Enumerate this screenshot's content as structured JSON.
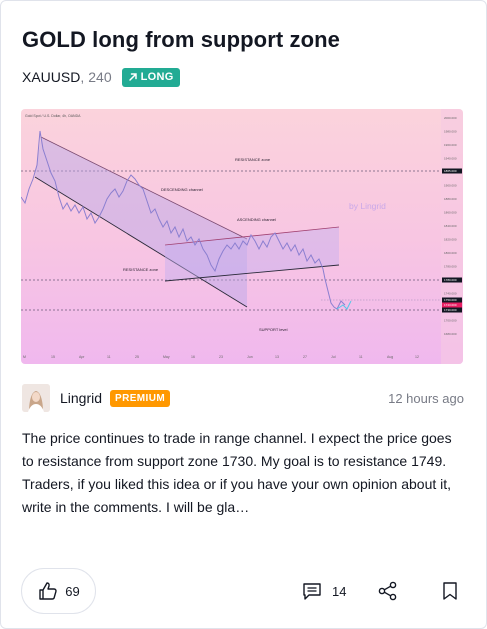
{
  "idea": {
    "title": "GOLD long from support zone",
    "symbol": "XAUUSD",
    "interval": "240",
    "direction": "LONG",
    "direction_color": "#22ab94"
  },
  "chart": {
    "header_text": "Gold Spot / U.S. Dollar, 4h, OANDA",
    "labels": {
      "resistance_top": "RESISTANCE zone",
      "descending": "DESCENDING channel",
      "ascending": "ASCENDING channel",
      "resistance_mid": "RESISTANCE zone",
      "support": "SUPPORT level",
      "watermark": "by Lingrid"
    },
    "x_ticks": [
      "M",
      "15",
      "Apr",
      "11",
      "25",
      "May",
      "16",
      "23",
      "Jun",
      "13",
      "27",
      "Jul",
      "11",
      "Aug",
      "12"
    ],
    "y_ticks": [
      "2000.000",
      "1980.000",
      "1960.000",
      "1940.000",
      "1920.000",
      "1900.000",
      "1880.000",
      "1860.000",
      "1840.000",
      "1820.000",
      "1800.000",
      "1780.000",
      "1760.000",
      "1740.000",
      "1720.000",
      "1700.000",
      "1680.000"
    ],
    "price_tags": [
      {
        "text": "1865.000",
        "color": "#131722"
      },
      {
        "text": "1780.000",
        "color": "#131722"
      },
      {
        "text": "1750.000",
        "color": "#131722"
      },
      {
        "text": "1743.000",
        "color": "#e91e63"
      },
      {
        "text": "1730.000",
        "color": "#131722"
      }
    ]
  },
  "author": {
    "name": "Lingrid",
    "badge": "PREMIUM",
    "badge_color": "#ff9800",
    "published": "12 hours ago"
  },
  "description": "The price continues to trade in range channel. I expect the price goes to resistance from support zone 1730. My goal is to resistance 1749. Traders, if you liked this idea or if you have your own opinion about it, write in the comments. I will be gla…",
  "actions": {
    "likes": "69",
    "comments": "14"
  },
  "icons": {
    "like": "thumbs-up-icon",
    "comment": "comment-icon",
    "share": "share-icon",
    "bookmark": "bookmark-icon",
    "long_arrow": "arrow-up-right-icon"
  }
}
